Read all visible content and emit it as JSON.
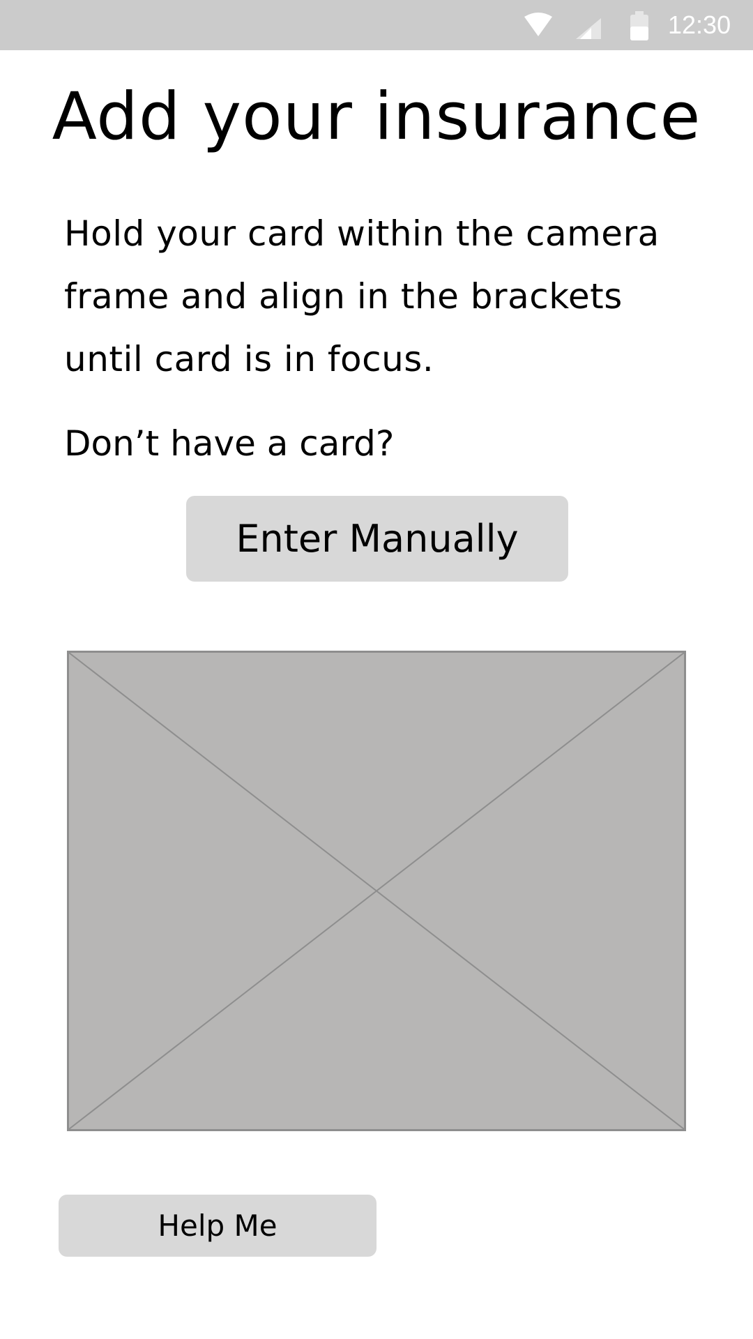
{
  "status_bar": {
    "time": "12:30",
    "icons": [
      "wifi-icon",
      "signal-icon",
      "battery-icon"
    ],
    "background": "#cbcbcb"
  },
  "page": {
    "title": "Add your insurance",
    "instructions": "Hold your card within the camera frame and align in the brackets until card is in focus.",
    "no_card_label": "Don’t have a card?"
  },
  "buttons": {
    "enter_manually": "Enter Manually",
    "help_me": "Help Me"
  },
  "camera_view": {
    "type": "image-placeholder",
    "fill": "#b7b6b5"
  }
}
